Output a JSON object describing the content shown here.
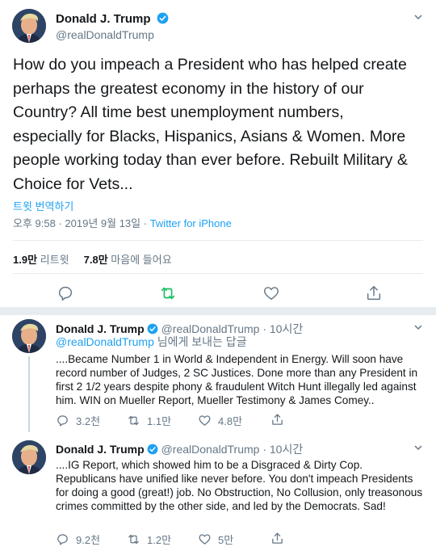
{
  "main_tweet": {
    "author_name": "Donald J. Trump",
    "handle": "@realDonaldTrump",
    "text": "How do you impeach a President who has helped create perhaps the greatest economy in the history of our Country? All time best unemployment numbers, especially for Blacks, Hispanics, Asians & Women. More people working today than ever before. Rebuilt Military & Choice for Vets...",
    "translate_label": "트윗 번역하기",
    "time": "오후 9:58",
    "date": "2019년 9월 13일",
    "source": "Twitter for iPhone",
    "retweets_count": "1.9만",
    "retweets_label": "리트윗",
    "likes_count": "7.8만",
    "likes_label": "마음에 들어요"
  },
  "replies": [
    {
      "author_name": "Donald J. Trump",
      "handle": "@realDonaldTrump",
      "time": "10시간",
      "replying_mention": "@realDonaldTrump",
      "replying_suffix": "님에게 보내는 답글",
      "text": "....Became Number 1 in World & Independent in Energy. Will soon have record number of Judges, 2 SC Justices. Done more than any President in first 2 1/2 years despite phony & fraudulent Witch Hunt illegally led against him. WIN on Mueller Report, Mueller Testimony & James Comey..",
      "replies_count": "3.2천",
      "retweets_count": "1.1만",
      "likes_count": "4.8만"
    },
    {
      "author_name": "Donald J. Trump",
      "handle": "@realDonaldTrump",
      "time": "10시간",
      "text": "....IG Report, which showed him to be a Disgraced & Dirty Cop. Republicans have unified like never before. You don't impeach Presidents for doing a good (great!) job. No Obstruction, No Collusion, only treasonous crimes committed by the other side, and led by the Democrats. Sad!",
      "replies_count": "9.2천",
      "retweets_count": "1.2만",
      "likes_count": "5만"
    }
  ],
  "colors": {
    "accent": "#1da1f2",
    "retweet_green": "#17bf63",
    "muted": "#657786",
    "divider": "#e6ecf0"
  },
  "icons": [
    "verified-badge-icon",
    "chevron-down-icon",
    "reply-icon",
    "retweet-icon",
    "like-icon",
    "share-icon"
  ]
}
